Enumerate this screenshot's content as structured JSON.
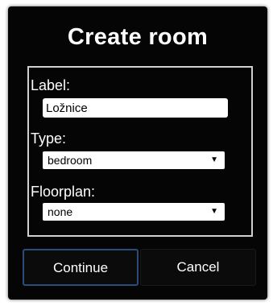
{
  "dialog": {
    "title": "Create room",
    "label_field": {
      "label": "Label:",
      "value": "Ložnice"
    },
    "type_field": {
      "label": "Type:",
      "selected": "bedroom"
    },
    "floorplan_field": {
      "label": "Floorplan:",
      "selected": "none"
    },
    "buttons": {
      "continue": "Continue",
      "cancel": "Cancel"
    }
  },
  "colors": {
    "dialog_background": "#050505",
    "text": "#ffffff",
    "continue_border": "#2a4c7a"
  },
  "icons": {
    "dropdown": "caret-down-icon"
  }
}
